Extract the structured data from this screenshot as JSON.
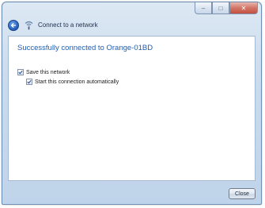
{
  "window": {
    "title": "Connect to a network",
    "icons": {
      "back": "back-arrow-icon",
      "network": "wireless-network-icon"
    },
    "caption_buttons": [
      "minimize",
      "maximize",
      "close"
    ]
  },
  "main": {
    "heading": "Successfully connected to Orange-01BD",
    "options": [
      {
        "label": "Save this network",
        "checked": true
      },
      {
        "label": "Start this connection automatically",
        "checked": true
      }
    ]
  },
  "footer": {
    "close_label": "Close"
  },
  "colors": {
    "heading": "#1f5db3",
    "frame": "#c9dbee"
  }
}
